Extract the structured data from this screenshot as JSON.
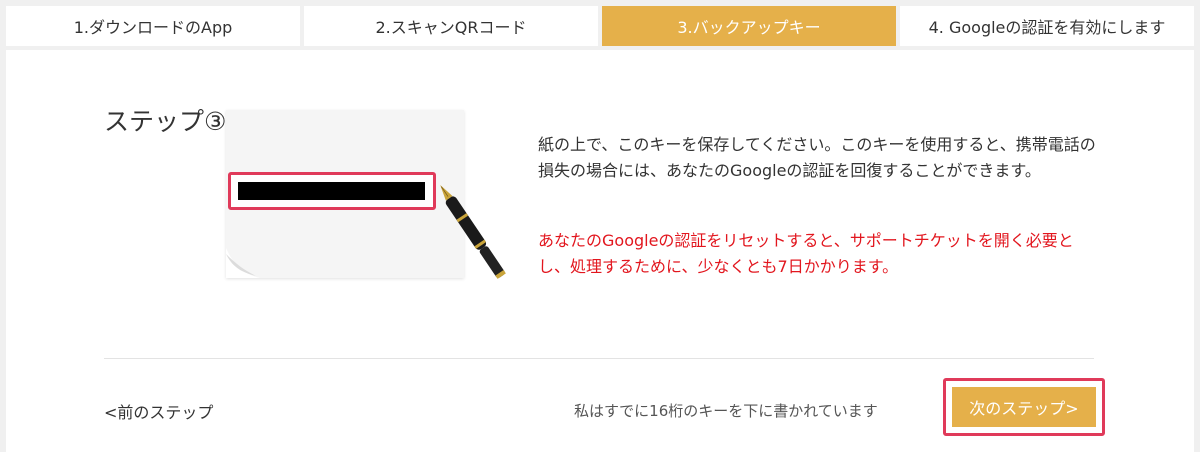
{
  "tabs": [
    {
      "label": "1.ダウンロードのApp",
      "active": false
    },
    {
      "label": "2.スキャンQRコード",
      "active": false
    },
    {
      "label": "3.バックアップキー",
      "active": true
    },
    {
      "label": "4. Googleの認証を有効にします",
      "active": false
    }
  ],
  "step": {
    "title": "ステップ③"
  },
  "illustration": {
    "paper_icon": "paper-sheet",
    "pen_icon": "fountain-pen",
    "key_value_redacted": true
  },
  "content": {
    "description": "紙の上で、このキーを保存してください。このキーを使用すると、携帯電話の損失の場合には、あなたのGoogleの認証を回復することができます。",
    "warning": "あなたのGoogleの認証をリセットすると、サポートチケットを開く必要とし、処理するために、少なくとも7日かかります。"
  },
  "footer": {
    "prev_label": "<前のステップ",
    "confirm_text": "私はすでに16桁のキーを下に書かれています",
    "next_label": "次のステップ>"
  },
  "colors": {
    "accent": "#e5b04a",
    "warning": "#e2161e",
    "highlight_frame": "#e03a5a"
  }
}
